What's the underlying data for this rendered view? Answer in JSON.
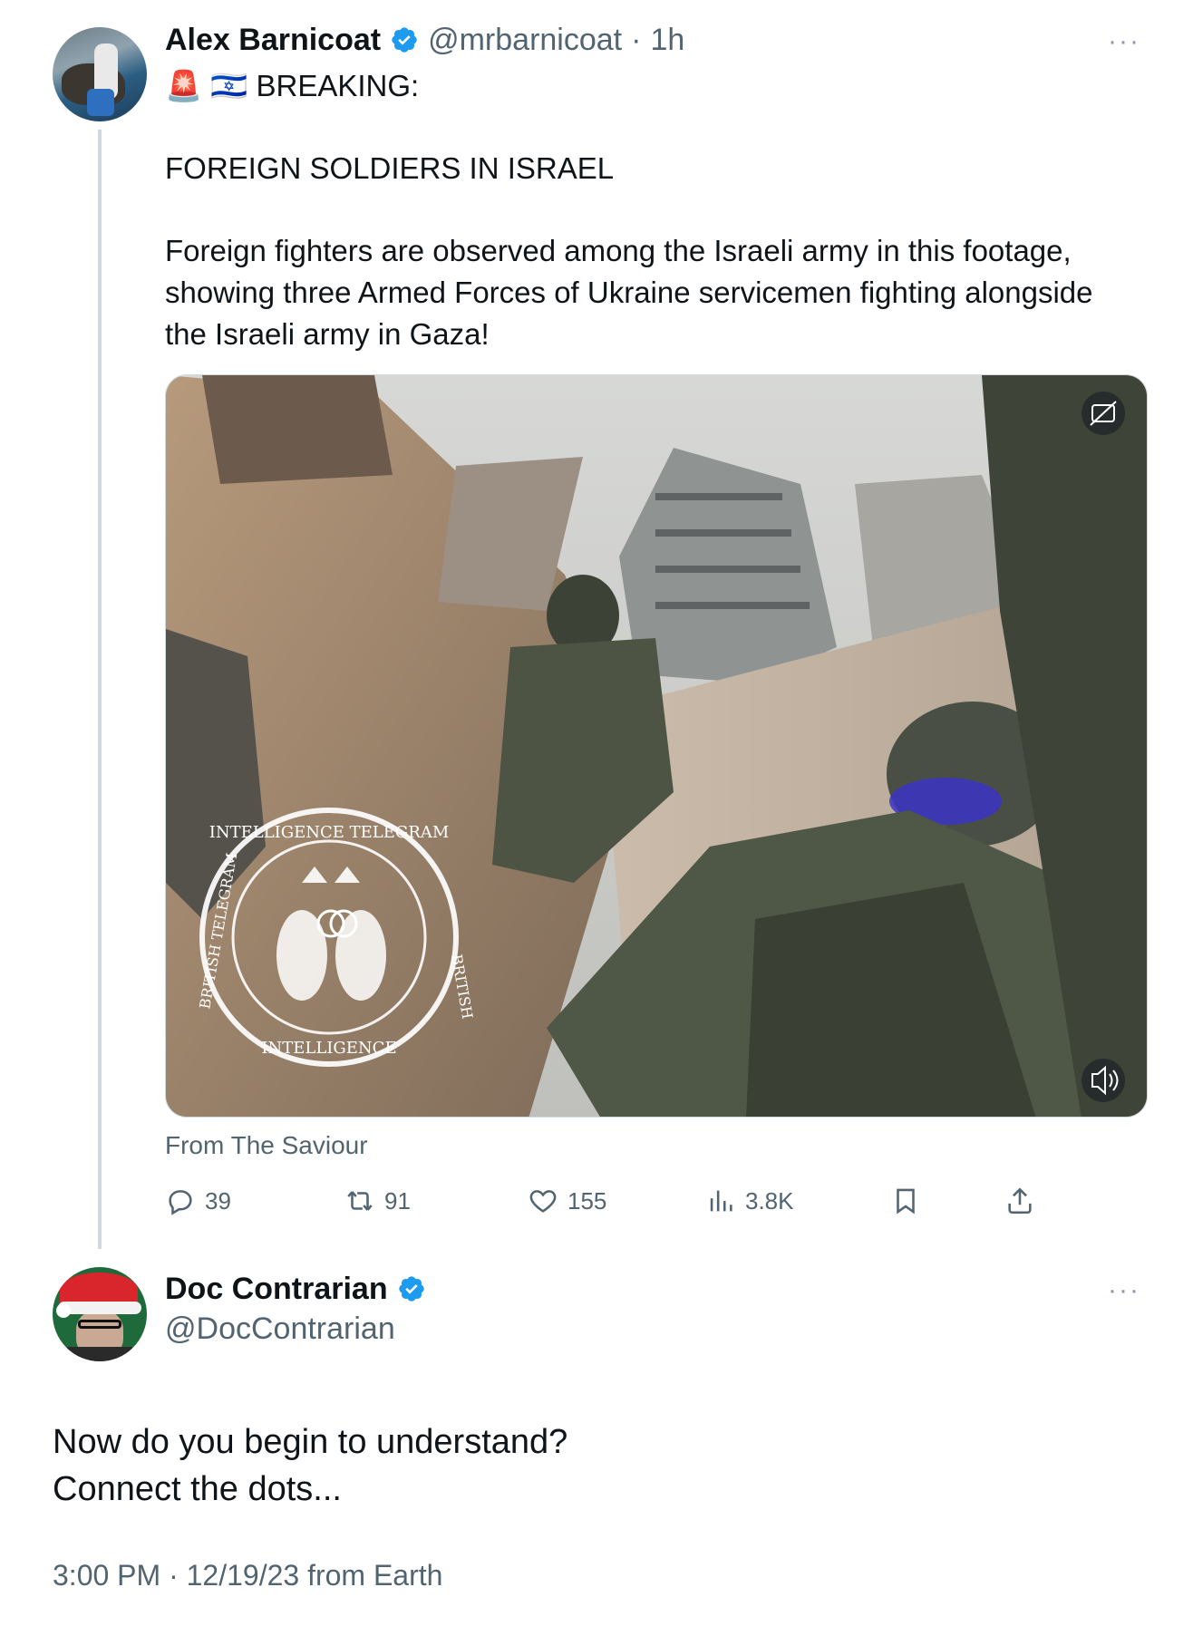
{
  "original_tweet": {
    "author_name": "Alex Barnicoat",
    "handle": "@mrbarnicoat",
    "separator": "·",
    "time_ago": "1h",
    "more": "···",
    "emoji_line": "🚨 🇮🇱 BREAKING:",
    "paragraph_1": "FOREIGN SOLDIERS IN ISRAEL",
    "paragraph_2_line_1": "Foreign fighters are observed among the Israeli army in this footage,",
    "paragraph_2_line_2": "showing three Armed Forces of Ukraine servicemen fighting alongside",
    "paragraph_2_line_3": "the Israeli army in Gaza!",
    "media": {
      "watermark_top": "INTELLIGENCE TELEGRAM",
      "watermark_bottom": "INTELLIGENCE",
      "watermark_side": "BRITISH",
      "watermark_side_left": "BRITISH TELEGRAM",
      "captions_icon": "captions-off-icon",
      "volume_icon": "volume-icon"
    },
    "source": "From The Saviour",
    "actions": {
      "replies": "39",
      "reposts": "91",
      "likes": "155",
      "views": "3.8K"
    }
  },
  "reply_tweet": {
    "author_name": "Doc Contrarian",
    "handle": "@DocContrarian",
    "more": "···",
    "text_line_1": "Now do you begin to understand?",
    "text_line_2": "Connect the dots...",
    "timestamp": "3:00 PM · 12/19/23 from Earth"
  },
  "colors": {
    "verified": "#1d9bf0",
    "secondary_text": "#536471",
    "primary_text": "#0f1419",
    "thread_line": "#cfd9de"
  }
}
